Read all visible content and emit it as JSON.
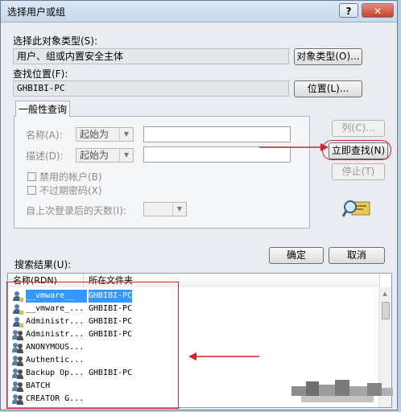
{
  "window": {
    "title": "选择用户或组",
    "help": "?",
    "close": "✕"
  },
  "object_type": {
    "label": "选择此对象类型(S):",
    "value": "用户、组或内置安全主体",
    "button": "对象类型(O)..."
  },
  "location": {
    "label": "查找位置(F):",
    "value": "GHBIBI-PC",
    "button": "位置(L)..."
  },
  "query": {
    "tab": "一般性查询",
    "name_label": "名称(A):",
    "name_op": "起始为",
    "desc_label": "描述(D):",
    "desc_op": "起始为",
    "disabled_accounts": "禁用的帐户(B)",
    "non_expiring_pw": "不过期密码(X)",
    "days_label": "自上次登录后的天数(I):"
  },
  "actions": {
    "columns": "列(C)...",
    "find_now": "立即查找(N)",
    "stop": "停止(T)"
  },
  "dialog": {
    "ok": "确定",
    "cancel": "取消"
  },
  "results": {
    "label": "搜索结果(U):",
    "columns": [
      "名称(RDN)",
      "所在文件夹"
    ],
    "rows": [
      {
        "name": "__vmware__",
        "folder": "GHBIBI-PC",
        "selected": true,
        "icon": "user-icon"
      },
      {
        "name": "__vmware_...",
        "folder": "GHBIBI-PC",
        "selected": false,
        "icon": "user-icon"
      },
      {
        "name": "Administr...",
        "folder": "GHBIBI-PC",
        "selected": false,
        "icon": "user-icon"
      },
      {
        "name": "Administr...",
        "folder": "GHBIBI-PC",
        "selected": false,
        "icon": "group-icon"
      },
      {
        "name": "ANONYMOUS...",
        "folder": "",
        "selected": false,
        "icon": "group-icon"
      },
      {
        "name": "Authentic...",
        "folder": "",
        "selected": false,
        "icon": "group-icon"
      },
      {
        "name": "Backup Op...",
        "folder": "GHBIBI-PC",
        "selected": false,
        "icon": "group-icon"
      },
      {
        "name": "BATCH",
        "folder": "",
        "selected": false,
        "icon": "group-icon"
      },
      {
        "name": "CREATOR G...",
        "folder": "",
        "selected": false,
        "icon": "group-icon"
      }
    ]
  },
  "colors": {
    "annotation": "#d1242a",
    "selection": "#3399ff"
  }
}
